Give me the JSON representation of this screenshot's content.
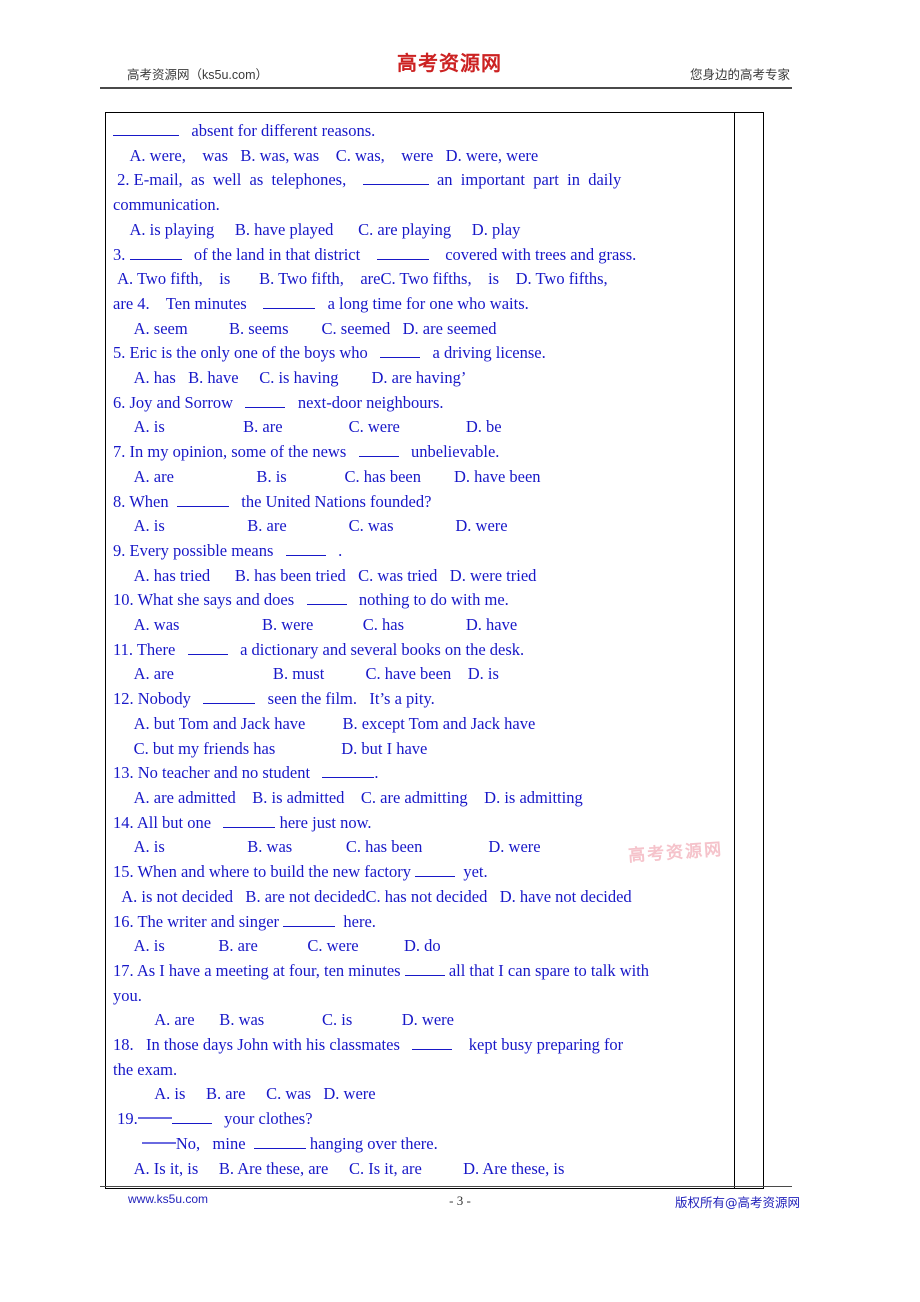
{
  "header": {
    "left_text": "高考资源网（ks5u.com）",
    "logo_text": "高考资源网",
    "right_text": "您身边的高考专家"
  },
  "watermark": {
    "text": "高考资源网"
  },
  "footer": {
    "left_text": "www.ks5u.com",
    "page_number": "- 3 -",
    "right_text": "版权所有@高考资源网"
  },
  "questions": {
    "lines": [
      {
        "id": "l01",
        "text": "absent for different reasons.",
        "lead_blank": "lg",
        "indent": 0
      },
      {
        "id": "l02",
        "text": "    A. were,    was   B. was, was    C. was,    were   D. were, were"
      },
      {
        "id": "l03",
        "text": "2. E-mail, as well as telephones,"
      },
      {
        "id": "l04",
        "text": "an important part in daily communication."
      },
      {
        "id": "l05",
        "text": "    A. is playing     B. have played      C. are playing     D. play"
      },
      {
        "id": "l06",
        "text": "3."
      },
      {
        "id": "l07",
        "text": "of the land in that district"
      },
      {
        "id": "l08",
        "text": "covered with trees and grass."
      },
      {
        "id": "l09",
        "text": " A. Two fifth,    is        B. Two fifth,    areC. Two fifths,    is    D. Two fifths, are 4.    Ten minutes"
      },
      {
        "id": "l10",
        "text": "a long time for one who waits."
      },
      {
        "id": "l11",
        "text": "     A. seem          B. seems        C. seemed   D. are seemed"
      },
      {
        "id": "l12",
        "text": "5. Eric is the only one of the boys who"
      },
      {
        "id": "l13",
        "text": "a driving license."
      },
      {
        "id": "l14",
        "text": "     A. has   B. have     C. is having        D. are having’"
      },
      {
        "id": "l15",
        "text": "6. Joy and Sorrow"
      },
      {
        "id": "l16",
        "text": "next-door neighbours."
      },
      {
        "id": "l17",
        "text": "     A. is                   B. are                C. were                D. be"
      },
      {
        "id": "l18",
        "text": "7. In my opinion, some of the news"
      },
      {
        "id": "l19",
        "text": "unbelievable."
      },
      {
        "id": "l20",
        "text": "     A. are                    B. is              C. has been        D. have been"
      },
      {
        "id": "l21",
        "text": "8. When"
      },
      {
        "id": "l22",
        "text": "the United Nations founded?"
      },
      {
        "id": "l23",
        "text": "     A. is                    B. are               C. was               D. were"
      },
      {
        "id": "l24",
        "text": "9. Every possible means"
      },
      {
        "id": "l25",
        "text": "."
      },
      {
        "id": "l26",
        "text": "     A. has tried      B. has been tried   C. was tried   D. were tried"
      },
      {
        "id": "l27",
        "text": "10. What she says and does"
      },
      {
        "id": "l28",
        "text": "nothing to do with me."
      },
      {
        "id": "l29",
        "text": "     A. was                    B. were            C. has               D. have"
      },
      {
        "id": "l30",
        "text": "11. There"
      },
      {
        "id": "l31",
        "text": "a dictionary and several books on the desk."
      },
      {
        "id": "l32",
        "text": "     A. are                        B. must          C. have been    D. is"
      },
      {
        "id": "l33",
        "text": "12. Nobody"
      },
      {
        "id": "l34",
        "text": "seen the film.   It’s a pity."
      },
      {
        "id": "l35",
        "text": "     A. but Tom and Jack have         B. except Tom and Jack have"
      },
      {
        "id": "l36",
        "text": "     C. but my friends has                D. but I have"
      },
      {
        "id": "l37",
        "text": "13. No teacher and no student"
      },
      {
        "id": "l38",
        "text": "."
      },
      {
        "id": "l39",
        "text": "     A. are admitted    B. is admitted    C. are admitting    D. is admitting"
      },
      {
        "id": "l40",
        "text": "14. All but one"
      },
      {
        "id": "l41",
        "text": "here just now."
      },
      {
        "id": "l42",
        "text": "     A. is                    B. was             C. has been                D. were"
      },
      {
        "id": "l43",
        "text": "15. When and where to build the new factory"
      },
      {
        "id": "l44",
        "text": "yet."
      },
      {
        "id": "l45",
        "text": "  A. is not decided   B. are not decidedC. has not decided   D. have not decided"
      },
      {
        "id": "l46",
        "text": "16. The writer and singer"
      },
      {
        "id": "l47",
        "text": "here."
      },
      {
        "id": "l48",
        "text": "    A. is             B. are            C. were           D. do"
      },
      {
        "id": "l49",
        "text": "17. As I have a meeting at four, ten minutes"
      },
      {
        "id": "l50",
        "text": "all that I can spare to talk with you."
      },
      {
        "id": "l51",
        "text": "          A. are      B. was              C. is            D. were"
      },
      {
        "id": "l52",
        "text": "18.   In those days John with his classmates"
      },
      {
        "id": "l53",
        "text": "kept busy preparing for the exam."
      },
      {
        "id": "l54",
        "text": "          A. is     B. are     C. was   D. were"
      },
      {
        "id": "l55",
        "text": "19."
      },
      {
        "id": "l56",
        "text": "your clothes?"
      },
      {
        "id": "l57",
        "text": "No,   mine"
      },
      {
        "id": "l58",
        "text": "hanging over there."
      },
      {
        "id": "l59",
        "text": "     A. Is it, is     B. Are these, are     C. Is it, are          D. Are these, is"
      }
    ],
    "q1_tail": "absent for different reasons.",
    "q1_opts": "    A. were,    was   B. was, was    C. was,    were   D. were, were",
    "q2_a": "2. E-mail,  as  well  as  telephones,",
    "q2_b": "an  important  part  in  daily",
    "q2_c": "communication.",
    "q2_opts": "    A. is playing     B. have played      C. are playing     D. play",
    "q3_a": "3.",
    "q3_b": "of the land in that district",
    "q3_c": "covered with trees and grass.",
    "q3_opts_a": " A. Two fifth,    is       B. Two fifth,    areC. Two fifths,    is    D. Two fifths,",
    "q3_opts_b": "are 4.    Ten minutes",
    "q4_tail": "a long time for one who waits.",
    "q4_opts": "     A. seem          B. seems        C. seemed   D. are seemed",
    "q5_a": "5. Eric is the only one of the boys who",
    "q5_b": "a driving license.",
    "q5_opts": "     A. has   B. have     C. is having        D. are having’",
    "q6_a": "6. Joy and Sorrow",
    "q6_b": "next-door neighbours.",
    "q6_opts": "     A. is                   B. are                C. were                D. be",
    "q7_a": "7. In my opinion, some of the news",
    "q7_b": "unbelievable.",
    "q7_opts": "     A. are                    B. is              C. has been        D. have been",
    "q8_a": "8. When",
    "q8_b": "the United Nations founded?",
    "q8_opts": "     A. is                    B. are               C. was               D. were",
    "q9_a": "9. Every possible means",
    "q9_b": ".",
    "q9_opts": "     A. has tried      B. has been tried   C. was tried   D. were tried",
    "q10_a": "10. What she says and does",
    "q10_b": "nothing to do with me.",
    "q10_opts": "     A. was                    B. were            C. has               D. have",
    "q11_a": "11. There",
    "q11_b": "a dictionary and several books on the desk.",
    "q11_opts": "     A. are                        B. must          C. have been    D. is",
    "q12_a": "12. Nobody",
    "q12_b": "seen the film.   It’s a pity.",
    "q12_opts_a": "     A. but Tom and Jack have         B. except Tom and Jack have",
    "q12_opts_b": "     C. but my friends has                D. but I have",
    "q13_a": "13. No teacher and no student",
    "q13_b": ".",
    "q13_opts": "     A. are admitted    B. is admitted    C. are admitting    D. is admitting",
    "q14_a": "14. All but one",
    "q14_b": "here just now.",
    "q14_opts": "     A. is                    B. was             C. has been                D. were",
    "q15_a": "15. When and where to build the new factory",
    "q15_b": "yet.",
    "q15_opts": "  A. is not decided   B. are not decidedC. has not decided   D. have not decided",
    "q16_a": "16. The writer and singer",
    "q16_b": "here.",
    "q16_opts": "     A. is             B. are            C. were           D. do",
    "q17_a": "17. As I have a meeting at four, ten minutes",
    "q17_b": "all that I can spare to talk with",
    "q17_c": "you.",
    "q17_opts": "          A. are      B. was              C. is            D. were",
    "q18_a": "18.   In those days John with his classmates",
    "q18_b": "kept busy preparing for",
    "q18_c": "the exam.",
    "q18_opts": "          A. is     B. are     C. was   D. were",
    "q19_a": "19.",
    "q19_b": "your clothes?",
    "q19_c": "No,   mine",
    "q19_d": "hanging over there.",
    "q19_opts": "     A. Is it, is     B. Are these, are     C. Is it, are          D. Are these, is"
  }
}
